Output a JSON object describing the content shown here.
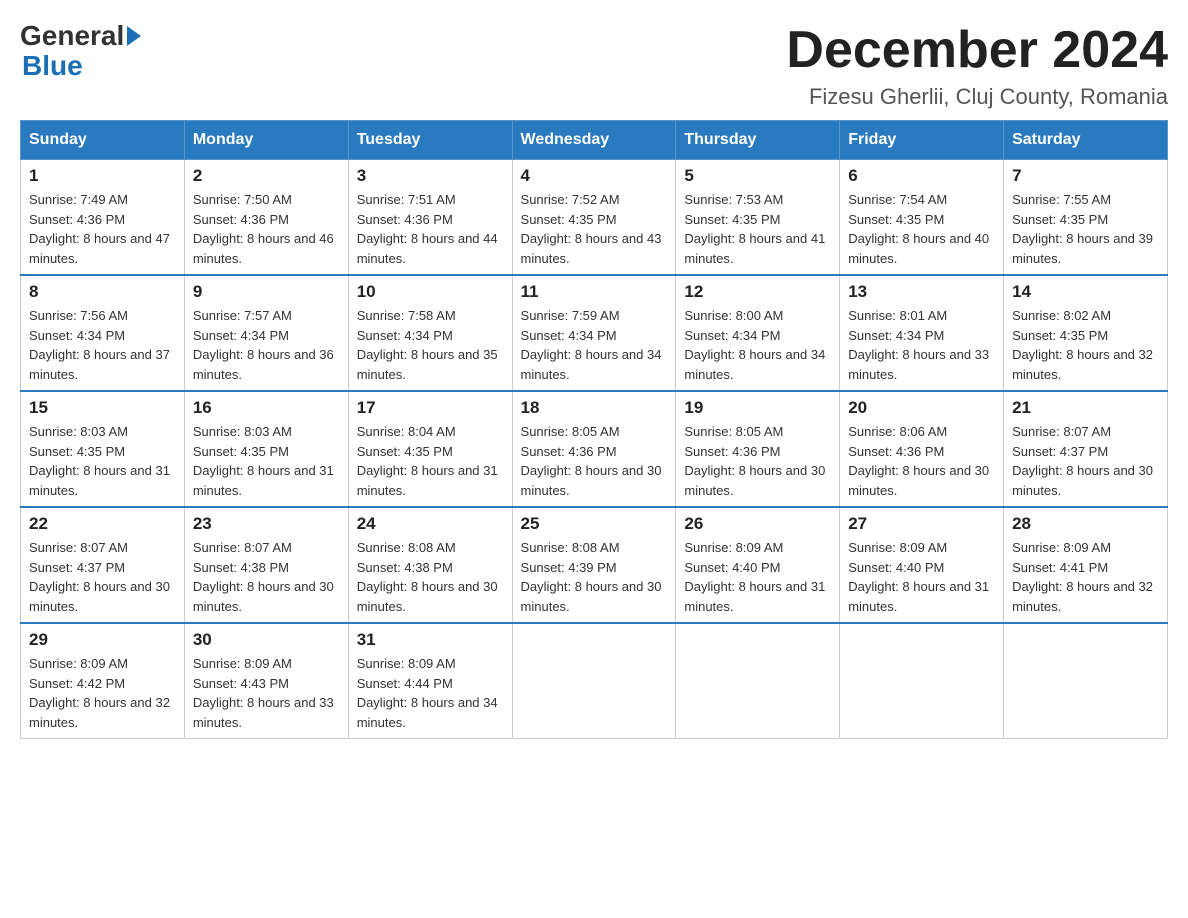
{
  "header": {
    "logo": {
      "general": "General",
      "blue": "Blue"
    },
    "title": "December 2024",
    "location": "Fizesu Gherlii, Cluj County, Romania"
  },
  "weekdays": [
    "Sunday",
    "Monday",
    "Tuesday",
    "Wednesday",
    "Thursday",
    "Friday",
    "Saturday"
  ],
  "weeks": [
    [
      {
        "day": "1",
        "sunrise": "Sunrise: 7:49 AM",
        "sunset": "Sunset: 4:36 PM",
        "daylight": "Daylight: 8 hours and 47 minutes."
      },
      {
        "day": "2",
        "sunrise": "Sunrise: 7:50 AM",
        "sunset": "Sunset: 4:36 PM",
        "daylight": "Daylight: 8 hours and 46 minutes."
      },
      {
        "day": "3",
        "sunrise": "Sunrise: 7:51 AM",
        "sunset": "Sunset: 4:36 PM",
        "daylight": "Daylight: 8 hours and 44 minutes."
      },
      {
        "day": "4",
        "sunrise": "Sunrise: 7:52 AM",
        "sunset": "Sunset: 4:35 PM",
        "daylight": "Daylight: 8 hours and 43 minutes."
      },
      {
        "day": "5",
        "sunrise": "Sunrise: 7:53 AM",
        "sunset": "Sunset: 4:35 PM",
        "daylight": "Daylight: 8 hours and 41 minutes."
      },
      {
        "day": "6",
        "sunrise": "Sunrise: 7:54 AM",
        "sunset": "Sunset: 4:35 PM",
        "daylight": "Daylight: 8 hours and 40 minutes."
      },
      {
        "day": "7",
        "sunrise": "Sunrise: 7:55 AM",
        "sunset": "Sunset: 4:35 PM",
        "daylight": "Daylight: 8 hours and 39 minutes."
      }
    ],
    [
      {
        "day": "8",
        "sunrise": "Sunrise: 7:56 AM",
        "sunset": "Sunset: 4:34 PM",
        "daylight": "Daylight: 8 hours and 37 minutes."
      },
      {
        "day": "9",
        "sunrise": "Sunrise: 7:57 AM",
        "sunset": "Sunset: 4:34 PM",
        "daylight": "Daylight: 8 hours and 36 minutes."
      },
      {
        "day": "10",
        "sunrise": "Sunrise: 7:58 AM",
        "sunset": "Sunset: 4:34 PM",
        "daylight": "Daylight: 8 hours and 35 minutes."
      },
      {
        "day": "11",
        "sunrise": "Sunrise: 7:59 AM",
        "sunset": "Sunset: 4:34 PM",
        "daylight": "Daylight: 8 hours and 34 minutes."
      },
      {
        "day": "12",
        "sunrise": "Sunrise: 8:00 AM",
        "sunset": "Sunset: 4:34 PM",
        "daylight": "Daylight: 8 hours and 34 minutes."
      },
      {
        "day": "13",
        "sunrise": "Sunrise: 8:01 AM",
        "sunset": "Sunset: 4:34 PM",
        "daylight": "Daylight: 8 hours and 33 minutes."
      },
      {
        "day": "14",
        "sunrise": "Sunrise: 8:02 AM",
        "sunset": "Sunset: 4:35 PM",
        "daylight": "Daylight: 8 hours and 32 minutes."
      }
    ],
    [
      {
        "day": "15",
        "sunrise": "Sunrise: 8:03 AM",
        "sunset": "Sunset: 4:35 PM",
        "daylight": "Daylight: 8 hours and 31 minutes."
      },
      {
        "day": "16",
        "sunrise": "Sunrise: 8:03 AM",
        "sunset": "Sunset: 4:35 PM",
        "daylight": "Daylight: 8 hours and 31 minutes."
      },
      {
        "day": "17",
        "sunrise": "Sunrise: 8:04 AM",
        "sunset": "Sunset: 4:35 PM",
        "daylight": "Daylight: 8 hours and 31 minutes."
      },
      {
        "day": "18",
        "sunrise": "Sunrise: 8:05 AM",
        "sunset": "Sunset: 4:36 PM",
        "daylight": "Daylight: 8 hours and 30 minutes."
      },
      {
        "day": "19",
        "sunrise": "Sunrise: 8:05 AM",
        "sunset": "Sunset: 4:36 PM",
        "daylight": "Daylight: 8 hours and 30 minutes."
      },
      {
        "day": "20",
        "sunrise": "Sunrise: 8:06 AM",
        "sunset": "Sunset: 4:36 PM",
        "daylight": "Daylight: 8 hours and 30 minutes."
      },
      {
        "day": "21",
        "sunrise": "Sunrise: 8:07 AM",
        "sunset": "Sunset: 4:37 PM",
        "daylight": "Daylight: 8 hours and 30 minutes."
      }
    ],
    [
      {
        "day": "22",
        "sunrise": "Sunrise: 8:07 AM",
        "sunset": "Sunset: 4:37 PM",
        "daylight": "Daylight: 8 hours and 30 minutes."
      },
      {
        "day": "23",
        "sunrise": "Sunrise: 8:07 AM",
        "sunset": "Sunset: 4:38 PM",
        "daylight": "Daylight: 8 hours and 30 minutes."
      },
      {
        "day": "24",
        "sunrise": "Sunrise: 8:08 AM",
        "sunset": "Sunset: 4:38 PM",
        "daylight": "Daylight: 8 hours and 30 minutes."
      },
      {
        "day": "25",
        "sunrise": "Sunrise: 8:08 AM",
        "sunset": "Sunset: 4:39 PM",
        "daylight": "Daylight: 8 hours and 30 minutes."
      },
      {
        "day": "26",
        "sunrise": "Sunrise: 8:09 AM",
        "sunset": "Sunset: 4:40 PM",
        "daylight": "Daylight: 8 hours and 31 minutes."
      },
      {
        "day": "27",
        "sunrise": "Sunrise: 8:09 AM",
        "sunset": "Sunset: 4:40 PM",
        "daylight": "Daylight: 8 hours and 31 minutes."
      },
      {
        "day": "28",
        "sunrise": "Sunrise: 8:09 AM",
        "sunset": "Sunset: 4:41 PM",
        "daylight": "Daylight: 8 hours and 32 minutes."
      }
    ],
    [
      {
        "day": "29",
        "sunrise": "Sunrise: 8:09 AM",
        "sunset": "Sunset: 4:42 PM",
        "daylight": "Daylight: 8 hours and 32 minutes."
      },
      {
        "day": "30",
        "sunrise": "Sunrise: 8:09 AM",
        "sunset": "Sunset: 4:43 PM",
        "daylight": "Daylight: 8 hours and 33 minutes."
      },
      {
        "day": "31",
        "sunrise": "Sunrise: 8:09 AM",
        "sunset": "Sunset: 4:44 PM",
        "daylight": "Daylight: 8 hours and 34 minutes."
      },
      null,
      null,
      null,
      null
    ]
  ]
}
